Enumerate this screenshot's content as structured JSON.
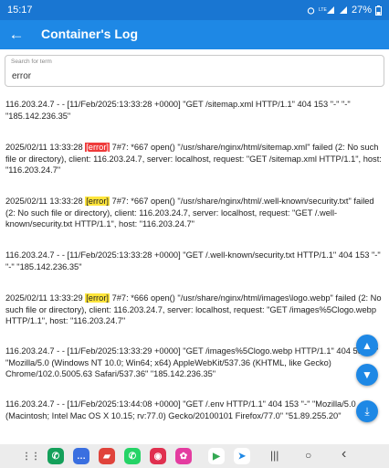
{
  "status_bar": {
    "time": "15:17",
    "battery": "27%"
  },
  "app_bar": {
    "title": "Container's Log"
  },
  "search": {
    "label": "Search for term",
    "value": "error"
  },
  "log_entries": [
    {
      "text": "116.203.24.7 - - [11/Feb/2025:13:33:28 +0000] \"GET /sitemap.xml HTTP/1.1\" 404 153 \"-\" \"-\" \"185.142.236.35\""
    },
    {
      "before": "2025/02/11 13:33:28 ",
      "highlight": "[error]",
      "after": " 7#7: *667 open() \"/usr/share/nginx/html/sitemap.xml\" failed (2: No such file or directory), client: 116.203.24.7, server: localhost, request: \"GET /sitemap.xml HTTP/1.1\", host: \"116.203.24.7\""
    },
    {
      "before": "2025/02/11 13:33:28 ",
      "highlight": "[error]",
      "after": " 7#7: *667 open() \"/usr/share/nginx/html/.well-known/security.txt\" failed (2: No such file or directory), client: 116.203.24.7, server: localhost, request: \"GET /.well-known/security.txt HTTP/1.1\", host: \"116.203.24.7\""
    },
    {
      "text": "116.203.24.7 - - [11/Feb/2025:13:33:28 +0000] \"GET /.well-known/security.txt HTTP/1.1\" 404 153 \"-\" \"-\" \"185.142.236.35\""
    },
    {
      "before": "2025/02/11 13:33:29 ",
      "highlight": "[error]",
      "after": " 7#7: *666 open() \"/usr/share/nginx/html/images\\logo.webp\" failed (2: No such file or directory), client: 116.203.24.7, server: localhost, request: \"GET /images%5Clogo.webp HTTP/1.1\", host: \"116.203.24.7\""
    },
    {
      "text": "116.203.24.7 - - [11/Feb/2025:13:33:29 +0000] \"GET /images%5Clogo.webp HTTP/1.1\" 404 555 \"-\" \"Mozilla/5.0 (Windows NT 10.0; Win64; x64) AppleWebKit/537.36 (KHTML, like Gecko) Chrome/102.0.5005.63 Safari/537.36\" \"185.142.236.35\""
    },
    {
      "text": "116.203.24.7 - - [11/Feb/2025:13:44:08 +0000] \"GET /.env HTTP/1.1\" 404 153 \"-\" \"Mozilla/5.0 (Macintosh; Intel Mac OS X 10.15; rv:77.0) Gecko/20100101 Firefox/77.0\" \"51.89.255.20\""
    }
  ],
  "fabs": {
    "up": "▲",
    "down": "▼",
    "bottom": "⤓"
  },
  "colors": {
    "accent": "#1e88e5",
    "highlight_active": "#ef3b3b",
    "highlight": "#ffe53b"
  },
  "nav_apps": [
    {
      "icon": "app-drawer-icon",
      "glyph": "⋮⋮",
      "color": "#666666"
    },
    {
      "icon": "phone-icon",
      "glyph": "✆",
      "color": "#14a05a"
    },
    {
      "icon": "messages-icon",
      "glyph": "…",
      "color": "#3a6fe0"
    },
    {
      "icon": "notes-icon",
      "glyph": "▰",
      "color": "#e0433b"
    },
    {
      "icon": "whatsapp-icon",
      "glyph": "✆",
      "color": "#25d366"
    },
    {
      "icon": "camera-icon",
      "glyph": "◉",
      "color": "#e0304f"
    },
    {
      "icon": "flower-app-icon",
      "glyph": "✿",
      "color": "#e43ca0"
    },
    {
      "icon": "play-store-icon",
      "glyph": "▶",
      "color": "#34a853"
    },
    {
      "icon": "send-app-icon",
      "glyph": "➤",
      "color": "#1e88e5"
    }
  ],
  "nav_system": {
    "recents": "|||",
    "home": "○",
    "back": "‹"
  }
}
